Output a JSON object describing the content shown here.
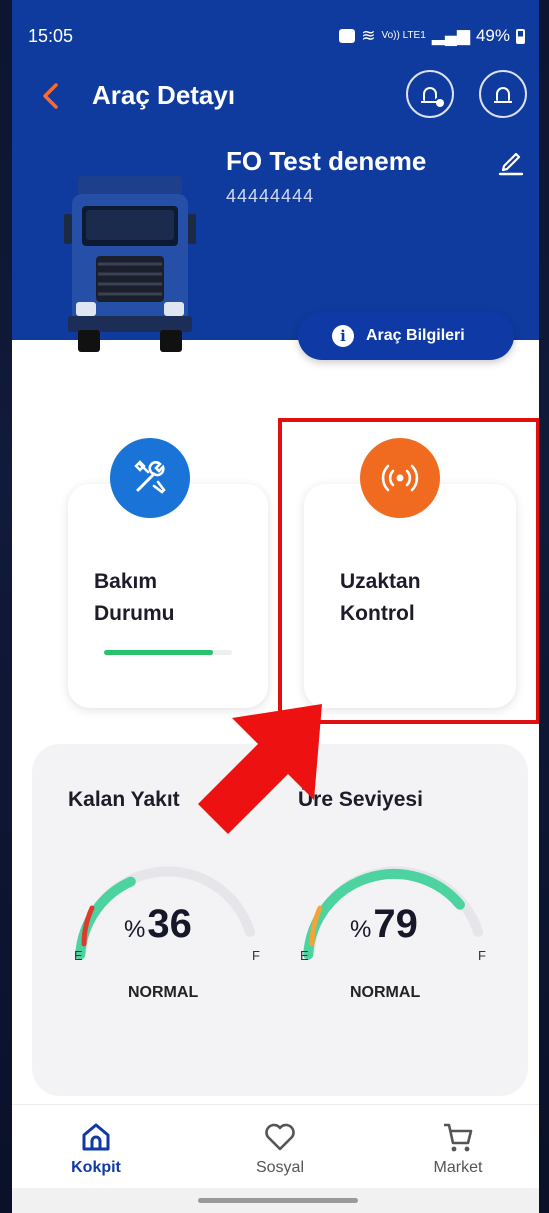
{
  "status_bar": {
    "time": "15:05",
    "signal_text": "Vo)) LTE1",
    "battery": "49%"
  },
  "header": {
    "title": "Araç Detayı",
    "vehicle_name": "FO Test deneme",
    "vehicle_plate": "44444444",
    "info_button_label": "Araç Bilgileri"
  },
  "cards": [
    {
      "label_line1": "Bakım",
      "label_line2": "Durumu",
      "icon": "wrench-screwdriver-icon",
      "progress": 0.85,
      "color": "#1a73d6"
    },
    {
      "label_line1": "Uzaktan",
      "label_line2": "Kontrol",
      "icon": "broadcast-icon",
      "color": "#f06b1f"
    }
  ],
  "gauges": [
    {
      "title": "Kalan Yakıt",
      "percent_symbol": "%",
      "value": "36",
      "status": "NORMAL",
      "empty_label": "E",
      "full_label": "F",
      "level": 0.36
    },
    {
      "title": "Üre Seviyesi",
      "percent_symbol": "%",
      "value": "79",
      "status": "NORMAL",
      "empty_label": "E",
      "full_label": "F",
      "level": 0.79
    }
  ],
  "bottom_nav": [
    {
      "label": "Kokpit",
      "icon": "home-icon",
      "active": true
    },
    {
      "label": "Sosyal",
      "icon": "heart-icon",
      "active": false
    },
    {
      "label": "Market",
      "icon": "cart-icon",
      "active": false
    }
  ],
  "colors": {
    "header_blue": "#0f3a9e",
    "accent_orange": "#f06b1f",
    "gauge_green": "#4dd3a0",
    "annotation_red": "#e01010"
  }
}
